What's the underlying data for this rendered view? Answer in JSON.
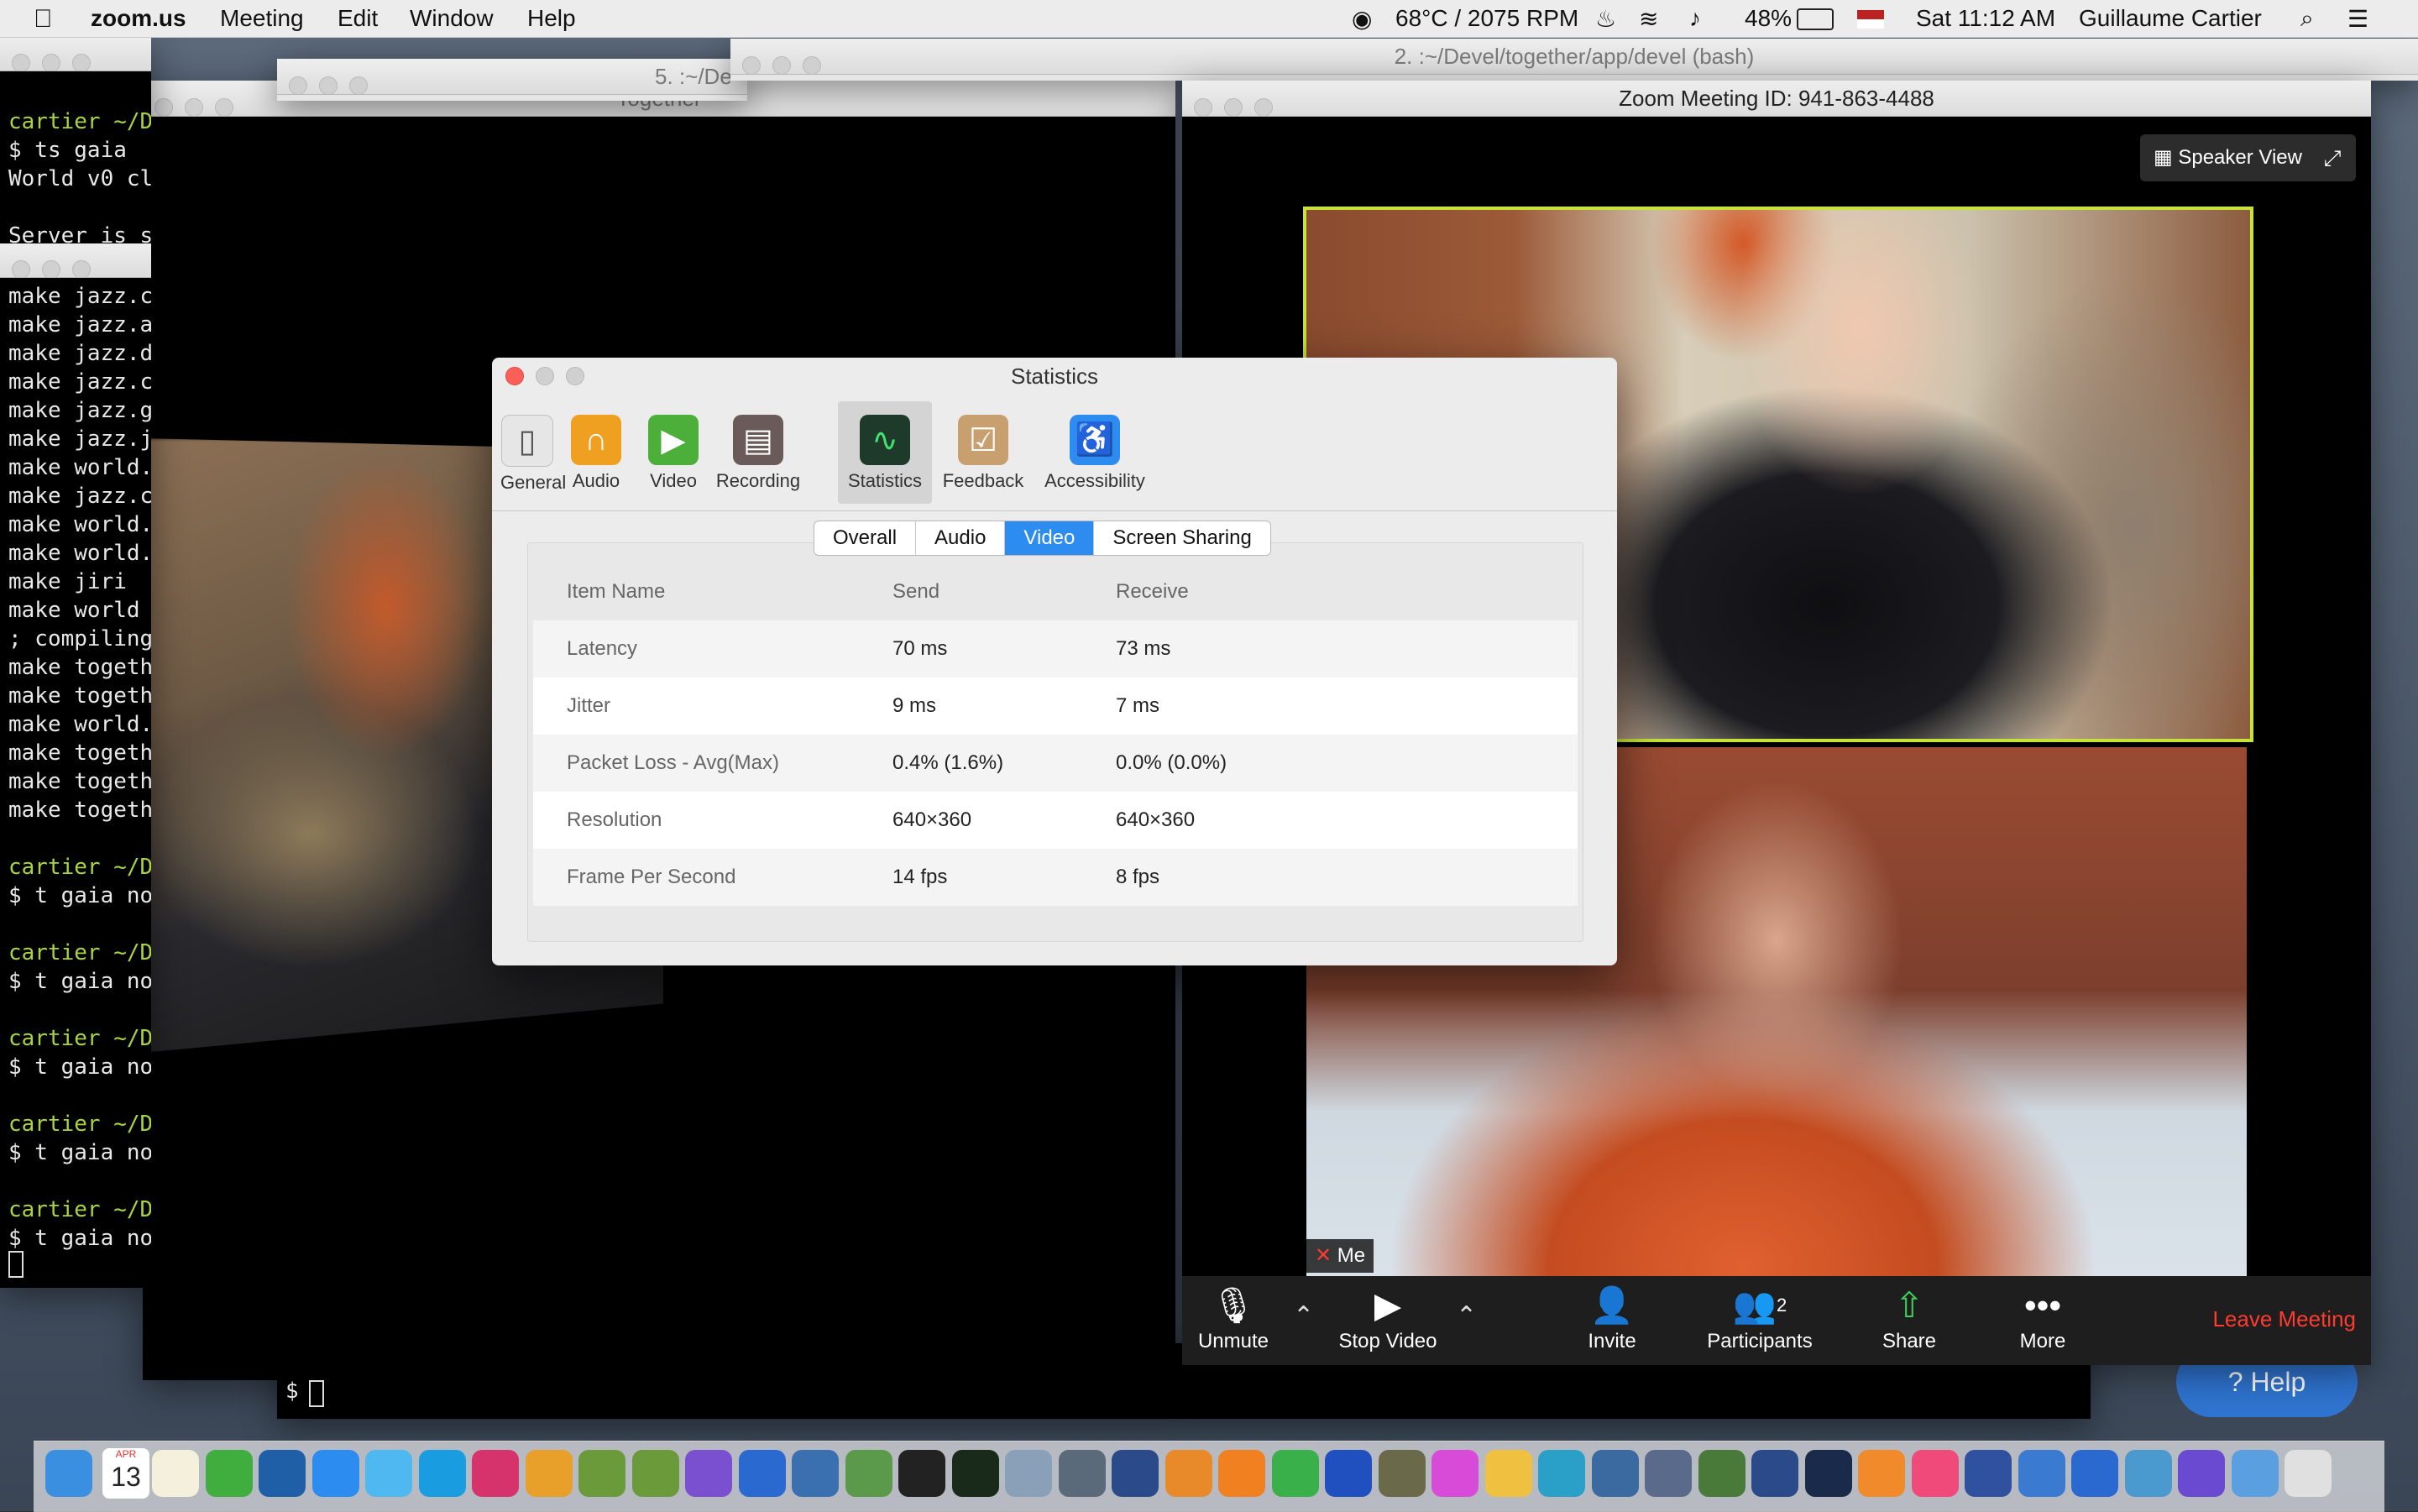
{
  "menubar": {
    "app_name": "zoom.us",
    "menus": [
      "Meeting",
      "Edit",
      "Window",
      "Help"
    ],
    "status": {
      "temp_fan": "68°C / 2075 RPM",
      "battery": "48%",
      "clock": "Sat 11:12 AM",
      "user": "Guillaume Cartier"
    }
  },
  "terminal_back": {
    "title1": "5. :~/De",
    "title2": "2. :~/Devel/together/app/devel (bash)"
  },
  "terminal_left": {
    "lines": [
      {
        "text": "cartier ~/D",
        "prompt": true
      },
      {
        "text": "$ ts gaia",
        "prompt": false
      },
      {
        "text": "World v0 cl",
        "prompt": false
      },
      {
        "text": "",
        "prompt": false
      },
      {
        "text": "Server is s",
        "prompt": false
      }
    ],
    "lines2": [
      "make jazz.c",
      "make jazz.a",
      "make jazz.d",
      "make jazz.c",
      "make jazz.g",
      "make jazz.j",
      "make world.",
      "make jazz.c",
      "make world.",
      "make world.",
      "make jiri",
      "make world",
      "; compiling",
      "make togeth",
      "make togeth",
      "make world.",
      "make togeth",
      "make togeth",
      "make togeth",
      "",
      "cartier ~/D",
      "$ t gaia no",
      "",
      "cartier ~/D",
      "$ t gaia no",
      "",
      "cartier ~/D",
      "$ t gaia no",
      "",
      "cartier ~/D",
      "$ t gaia no",
      "",
      "cartier ~/D",
      "$ t gaia no"
    ]
  },
  "together_window": {
    "title": "Together"
  },
  "zoom_window": {
    "title": "Zoom Meeting ID: 941-863-4488",
    "speaker_view": "Speaker View",
    "me_label": "Me",
    "toolbar": {
      "unmute": "Unmute",
      "stop_video": "Stop Video",
      "invite": "Invite",
      "participants": "Participants",
      "participants_count": "2",
      "share": "Share",
      "more": "More",
      "leave": "Leave Meeting"
    }
  },
  "statistics": {
    "title": "Statistics",
    "toolbar": [
      {
        "label": "General",
        "icon": "general-icon",
        "color": "#e6e6e6"
      },
      {
        "label": "Audio",
        "icon": "headphones-icon",
        "color": "#f0a020"
      },
      {
        "label": "Video",
        "icon": "video-camera-icon",
        "color": "#4caf3a"
      },
      {
        "label": "Recording",
        "icon": "film-icon",
        "color": "#6b5a5a"
      },
      {
        "label": "Statistics",
        "icon": "activity-monitor-icon",
        "color": "#1d3a2a"
      },
      {
        "label": "Feedback",
        "icon": "clipboard-icon",
        "color": "#c8a070"
      },
      {
        "label": "Accessibility",
        "icon": "accessibility-icon",
        "color": "#2d8cf0"
      }
    ],
    "tabs": [
      "Overall",
      "Audio",
      "Video",
      "Screen Sharing"
    ],
    "active_tab": "Video",
    "columns": [
      "Item Name",
      "Send",
      "Receive"
    ],
    "rows": [
      {
        "name": "Latency",
        "send": "70 ms",
        "receive": "73 ms"
      },
      {
        "name": "Jitter",
        "send": "9 ms",
        "receive": "7 ms"
      },
      {
        "name": "Packet Loss - Avg(Max)",
        "send": "0.4% (1.6%)",
        "receive": "0.0% (0.0%)"
      },
      {
        "name": "Resolution",
        "send": "640×360",
        "receive": "640×360"
      },
      {
        "name": "Frame Per Second",
        "send": "14 fps",
        "receive": "8 fps"
      }
    ]
  },
  "bottom_terminal": {
    "prompt": "$"
  },
  "help_button": {
    "label": "Help"
  },
  "dock": {
    "calendar_month": "APR",
    "calendar_day": "13",
    "apps": [
      "finder-icon",
      "calendar-icon",
      "notes-icon",
      "evernote-icon",
      "1password-icon",
      "zoom-icon",
      "messages-icon",
      "skype-icon",
      "app-icon",
      "chrome-icon",
      "app-icon",
      "app-icon",
      "app-icon",
      "globe-icon",
      "app-icon",
      "app-icon",
      "terminal-icon",
      "activity-monitor-icon",
      "preview-icon",
      "app-icon",
      "quicktime-icon",
      "blender-icon",
      "vlc-icon",
      "downloader-icon",
      "audio-icon",
      "gimp-icon",
      "app-icon",
      "photos-icon",
      "app-icon",
      "app-icon",
      "app-icon",
      "minecraft-icon",
      "app-icon",
      "steam-icon",
      "books-icon",
      "music-icon",
      "app-icon",
      "app-icon",
      "app-icon",
      "app-icon",
      "app-icon",
      "folder-icon",
      "trash-icon"
    ]
  }
}
